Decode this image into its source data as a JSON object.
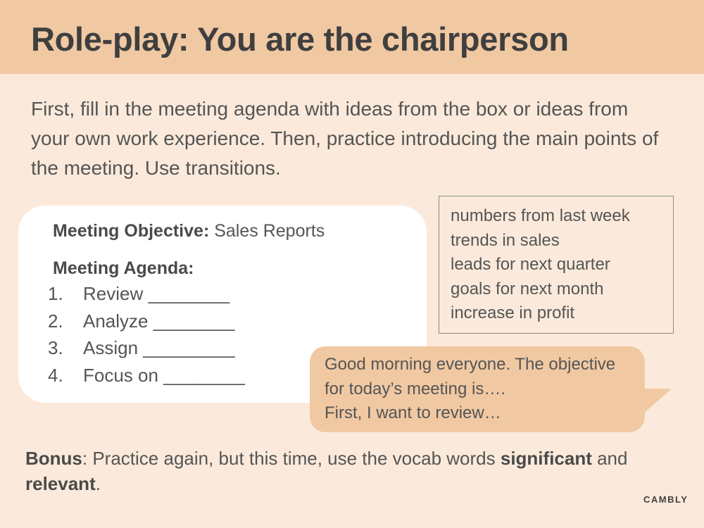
{
  "header": {
    "title": "Role-play: You are the chairperson"
  },
  "instructions": "First, fill in the meeting agenda with ideas from the box or ideas from your own work experience. Then, practice introducing the main points of the meeting. Use transitions.",
  "agenda_card": {
    "objective_label": "Meeting Objective:",
    "objective_value": "Sales Reports",
    "agenda_title": "Meeting Agenda:",
    "items": [
      {
        "number": "1.",
        "text": "Review ________"
      },
      {
        "number": "2.",
        "text": "Analyze ________"
      },
      {
        "number": "3.",
        "text": "Assign _________"
      },
      {
        "number": "4.",
        "text": "Focus on ________"
      }
    ]
  },
  "ideas_box": {
    "items": [
      "numbers from last week",
      "trends in sales",
      "leads for next quarter",
      "goals for next month",
      "increase in profit"
    ]
  },
  "speech_bubble": {
    "lines": [
      "Good morning everyone. The objective",
      "for today’s meeting is….",
      "First, I want to review…"
    ]
  },
  "bonus": {
    "label": "Bonus",
    "text_before": ": Practice again, but this time, use the vocab words ",
    "word1": "significant",
    "text_between": " and ",
    "word2": "relevant",
    "text_after": "."
  },
  "logo": {
    "text": "CAMBLY"
  },
  "colors": {
    "background": "#fbeadb",
    "header_band": "#f0c9a3",
    "speech_bubble": "#f0c9a3",
    "card": "#ffffff"
  }
}
